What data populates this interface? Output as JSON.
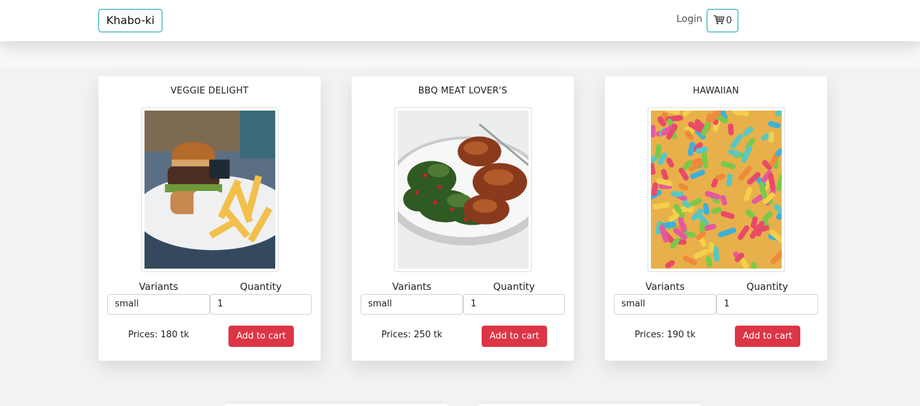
{
  "navbar": {
    "brand": "Khabo-ki",
    "login_label": "Login",
    "cart_count": "0",
    "cart_icon": "cart-icon"
  },
  "colors": {
    "accent_border": "#17a2b8",
    "button_red": "#dc3545",
    "page_background": "#f2f2f2"
  },
  "products": [
    {
      "name": "VEGGIE DELIGHT",
      "image": "burger-and-fries-photo",
      "variants_label": "Variants",
      "quantity_label": "Quantity",
      "variant": "small",
      "quantity": "1",
      "price": "Prices: 180 tk",
      "add_label": "Add to cart"
    },
    {
      "name": "BBQ MEAT LOVER'S",
      "image": "grilled-chicken-with-kale-photo",
      "variants_label": "Variants",
      "quantity_label": "Quantity",
      "variant": "small",
      "quantity": "1",
      "price": "Prices: 250 tk",
      "add_label": "Add to cart"
    },
    {
      "name": "HAWAIIAN",
      "image": "gummy-worms-candy-photo",
      "variants_label": "Variants",
      "quantity_label": "Quantity",
      "variant": "small",
      "quantity": "1",
      "price": "Prices: 190 tk",
      "add_label": "Add to cart"
    }
  ]
}
